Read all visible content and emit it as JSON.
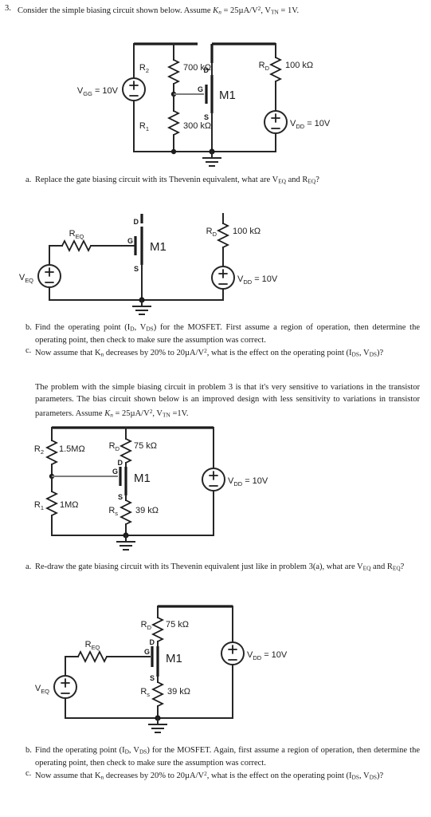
{
  "document": {
    "type": "homework-problem-sheet",
    "topic": "MOSFET biasing circuits"
  },
  "problem3": {
    "number": "3.",
    "stem_part1": "Consider the simple biasing circuit shown below.  Assume ",
    "stem_Kn": "K",
    "stem_Kn_sub": "n",
    "stem_eq1": " = ",
    "stem_Kn_val": "25µA/V",
    "stem_Kn_exp": "2",
    "stem_comma": ", ",
    "stem_Vtn": "V",
    "stem_Vtn_sub": "TN",
    "stem_eq2": " = ",
    "stem_Vtn_val": "1V."
  },
  "circuit1": {
    "name": "simple-biasing-circuit",
    "r2_label": "R",
    "r2_sub": "2",
    "r2_value": "700 kΩ",
    "r1_label": "R",
    "r1_sub": "1",
    "r1_value": "300 kΩ",
    "rd_label": "R",
    "rd_sub": "D",
    "rd_value": "100 kΩ",
    "vgg_label": "V",
    "vgg_sub": "GG",
    "vgg_value": " = 10V",
    "vdd_label": "V",
    "vdd_sub": "DD",
    "vdd_value": " = 10V",
    "mosfet": "M1",
    "pin_d": "D",
    "pin_g": "G",
    "pin_s": "S",
    "source_plus": "+",
    "source_minus": "-"
  },
  "q3a": {
    "letter": "a.",
    "text_1": "Replace the gate biasing circuit with its Thevenin equivalent, what are V",
    "sub_1": "EQ",
    "text_2": " and R",
    "sub_2": "EQ",
    "text_3": "?"
  },
  "circuit2": {
    "name": "thevenin-equivalent-circuit",
    "req_label": "R",
    "req_sub": "EQ",
    "veq_label": "V",
    "veq_sub": "EQ",
    "rd_label": "R",
    "rd_sub": "D",
    "rd_value": "100 kΩ",
    "vdd_label": "V",
    "vdd_sub": "DD",
    "vdd_value": " = 10V",
    "mosfet": "M1",
    "pin_d": "D",
    "pin_g": "G",
    "pin_s": "S",
    "source_plus": "+",
    "source_minus": "-"
  },
  "q3b": {
    "letter": "b.",
    "t1": "Find the operating point (I",
    "s1": "D",
    "t2": ", V",
    "s2": "DS",
    "t3": ") for the MOSFET.  First assume a region of operation, then determine the operating point, then check to make sure the assumption was correct."
  },
  "q3c": {
    "letter": "c.",
    "t1": "Now assume that K",
    "s1": "n",
    "t2": " decreases by 20% to 20µA/V",
    "e1": "2",
    "t3": ", what is the effect on the operating point (I",
    "s2": "DS",
    "t4": ", V",
    "s3": "DS",
    "t5": ")?"
  },
  "paragraph": {
    "t1": "The problem with the simple biasing circuit in problem 3 is that it's very sensitive to variations in the transistor parameters.   The bias circuit shown below is an improved design with less sensitivity to variations in transistor parameters. Assume ",
    "Kn": "K",
    "Kn_sub": "n",
    "eq1": " = ",
    "Kn_val": "25µA/V",
    "Kn_exp": "2",
    "comma": ", ",
    "Vtn": "V",
    "Vtn_sub": "TN",
    "eq2": " =",
    "Vtn_val": "1V."
  },
  "circuit3": {
    "name": "improved-bias-circuit",
    "r2_label": "R",
    "r2_sub": "2",
    "r2_value": "1.5MΩ",
    "r1_label": "R",
    "r1_sub": "1",
    "r1_value": "1MΩ",
    "rd_label": "R",
    "rd_sub": "D",
    "rd_value": "75 kΩ",
    "rs_label": "R",
    "rs_sub": "s",
    "rs_value": "39 kΩ",
    "vdd_label": "V",
    "vdd_sub": "DD",
    "vdd_value": " = 10V",
    "mosfet": "M1",
    "pin_d": "D",
    "pin_g": "G",
    "pin_s": "S",
    "source_plus": "+",
    "source_minus": "-"
  },
  "q4a": {
    "letter": "a.",
    "t1": "Re-draw the gate biasing circuit with its Thevenin equivalent just like in problem 3(a), what are V",
    "s1": "EQ",
    "t2": " and R",
    "s2": "EQ",
    "t3": "?"
  },
  "circuit4": {
    "name": "improved-thevenin-equivalent-circuit",
    "req_label": "R",
    "req_sub": "EQ",
    "veq_label": "V",
    "veq_sub": "EQ",
    "rd_label": "R",
    "rd_sub": "D",
    "rd_value": "75 kΩ",
    "rs_label": "R",
    "rs_sub": "s",
    "rs_value": "39 kΩ",
    "vdd_label": "V",
    "vdd_sub": "DD",
    "vdd_value": " = 10V",
    "mosfet": "M1",
    "pin_d": "D",
    "pin_g": "G",
    "pin_s": "S",
    "source_plus": "+",
    "source_minus": "-"
  },
  "q4b": {
    "letter": "b.",
    "t1": "Find the operating point (I",
    "s1": "D",
    "t2": ", V",
    "s2": "DS",
    "t3": ") for the MOSFET.  Again, first assume a region of operation, then determine the operating point, then check to make sure the assumption was correct."
  },
  "q4c": {
    "letter": "c.",
    "t1": "Now assume that K",
    "s1": "n",
    "t2": " decreases by 20% to 20µA/V",
    "e1": "2",
    "t3": ", what is the effect on the operating point (I",
    "s2": "DS",
    "t4": ", V",
    "s3": "DS",
    "t5": ")?"
  }
}
